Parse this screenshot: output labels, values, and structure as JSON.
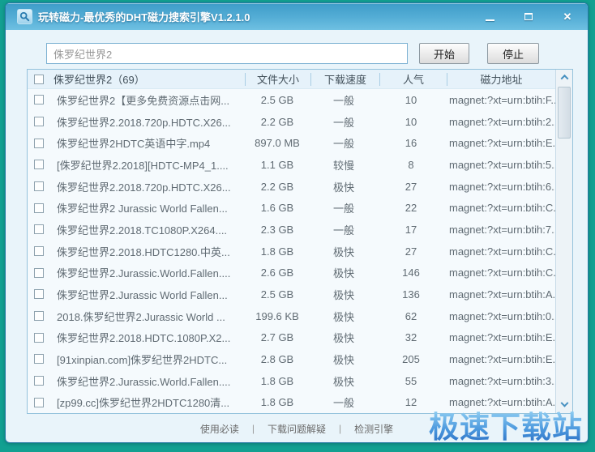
{
  "window": {
    "title": "玩转磁力-最优秀的DHT磁力搜索引擎V1.2.1.0"
  },
  "search": {
    "query": "侏罗纪世界2",
    "start_label": "开始",
    "stop_label": "停止"
  },
  "table": {
    "header": {
      "name": "侏罗纪世界2（69）",
      "size": "文件大小",
      "speed": "下载速度",
      "popularity": "人气",
      "magnet": "磁力地址"
    },
    "rows": [
      {
        "name": "侏罗纪世界2【更多免费资源点击网...",
        "size": "2.5 GB",
        "speed": "一般",
        "popularity": "10",
        "magnet": "magnet:?xt=urn:btih:F..."
      },
      {
        "name": "侏罗纪世界2.2018.720p.HDTC.X26...",
        "size": "2.2 GB",
        "speed": "一般",
        "popularity": "10",
        "magnet": "magnet:?xt=urn:btih:2..."
      },
      {
        "name": "侏罗纪世界2HDTC英语中字.mp4",
        "size": "897.0 MB",
        "speed": "一般",
        "popularity": "16",
        "magnet": "magnet:?xt=urn:btih:E..."
      },
      {
        "name": "[侏罗纪世界2.2018][HDTC-MP4_1....",
        "size": "1.1 GB",
        "speed": "较慢",
        "popularity": "8",
        "magnet": "magnet:?xt=urn:btih:5..."
      },
      {
        "name": "侏罗纪世界2.2018.720p.HDTC.X26...",
        "size": "2.2 GB",
        "speed": "极快",
        "popularity": "27",
        "magnet": "magnet:?xt=urn:btih:6..."
      },
      {
        "name": "侏罗纪世界2 Jurassic World Fallen...",
        "size": "1.6 GB",
        "speed": "一般",
        "popularity": "22",
        "magnet": "magnet:?xt=urn:btih:C..."
      },
      {
        "name": "侏罗纪世界2.2018.TC1080P.X264....",
        "size": "2.3 GB",
        "speed": "一般",
        "popularity": "17",
        "magnet": "magnet:?xt=urn:btih:7..."
      },
      {
        "name": "侏罗纪世界2.2018.HDTC1280.中英...",
        "size": "1.8 GB",
        "speed": "极快",
        "popularity": "27",
        "magnet": "magnet:?xt=urn:btih:C..."
      },
      {
        "name": "侏罗纪世界2.Jurassic.World.Fallen....",
        "size": "2.6 GB",
        "speed": "极快",
        "popularity": "146",
        "magnet": "magnet:?xt=urn:btih:C..."
      },
      {
        "name": "侏罗纪世界2.Jurassic World Fallen...",
        "size": "2.5 GB",
        "speed": "极快",
        "popularity": "136",
        "magnet": "magnet:?xt=urn:btih:A..."
      },
      {
        "name": "2018.侏罗纪世界2.Jurassic World ...",
        "size": "199.6 KB",
        "speed": "极快",
        "popularity": "62",
        "magnet": "magnet:?xt=urn:btih:0..."
      },
      {
        "name": "侏罗纪世界2.2018.HDTC.1080P.X2...",
        "size": "2.7 GB",
        "speed": "极快",
        "popularity": "32",
        "magnet": "magnet:?xt=urn:btih:E..."
      },
      {
        "name": "[91xinpian.com]侏罗纪世界2HDTC...",
        "size": "2.8 GB",
        "speed": "极快",
        "popularity": "205",
        "magnet": "magnet:?xt=urn:btih:E..."
      },
      {
        "name": "侏罗纪世界2.Jurassic.World.Fallen....",
        "size": "1.8 GB",
        "speed": "极快",
        "popularity": "55",
        "magnet": "magnet:?xt=urn:btih:3..."
      },
      {
        "name": "[zp99.cc]侏罗纪世界2HDTC1280清...",
        "size": "1.8 GB",
        "speed": "一般",
        "popularity": "12",
        "magnet": "magnet:?xt=urn:btih:A..."
      }
    ]
  },
  "footer": {
    "links": [
      "使用必读",
      "下载问题解疑",
      "检测引擎"
    ],
    "watermark": "极速下载站"
  },
  "colors": {
    "desktop_teal": "#12a091",
    "titlebar_blue": "#4aa5d1",
    "window_body": "#e9f4fa",
    "table_border": "#94c2dc",
    "watermark_blue": "#3d86d2"
  }
}
